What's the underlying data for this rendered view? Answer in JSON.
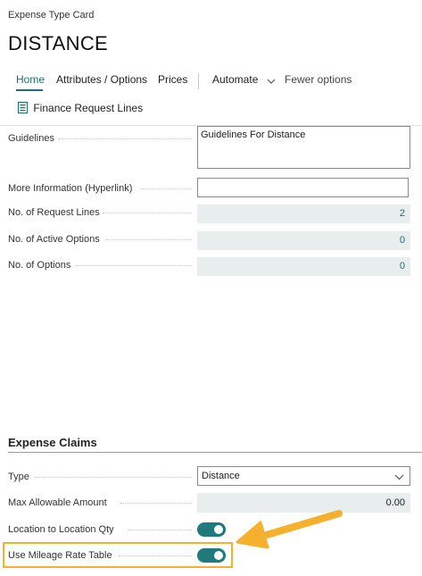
{
  "header": {
    "card_type": "Expense Type Card",
    "title": "DISTANCE"
  },
  "tabs": [
    {
      "label": "Home",
      "active": true
    },
    {
      "label": "Attributes / Options"
    },
    {
      "label": "Prices"
    },
    {
      "label": "Automate"
    },
    {
      "label": "Fewer options"
    }
  ],
  "actions": {
    "finance_request_lines": "Finance Request Lines"
  },
  "general": {
    "guidelines": {
      "label": "Guidelines",
      "value": "Guidelines For Distance"
    },
    "more_info": {
      "label": "More Information (Hyperlink)",
      "value": ""
    },
    "request_lines": {
      "label": "No. of Request Lines",
      "value": "2"
    },
    "active_options": {
      "label": "No. of Active Options",
      "value": "0"
    },
    "options": {
      "label": "No. of Options",
      "value": "0"
    }
  },
  "expense_claims": {
    "title": "Expense Claims",
    "type": {
      "label": "Type",
      "value": "Distance"
    },
    "max_amount": {
      "label": "Max Allowable Amount",
      "value": "0.00"
    },
    "location_qty": {
      "label": "Location to Location Qty",
      "enabled": true
    },
    "mileage_table": {
      "label": "Use Mileage Rate Table",
      "enabled": true
    }
  },
  "colors": {
    "accent": "#1f6f73",
    "highlight": "#f5b02e",
    "readonly_bg": "#e8eded"
  }
}
